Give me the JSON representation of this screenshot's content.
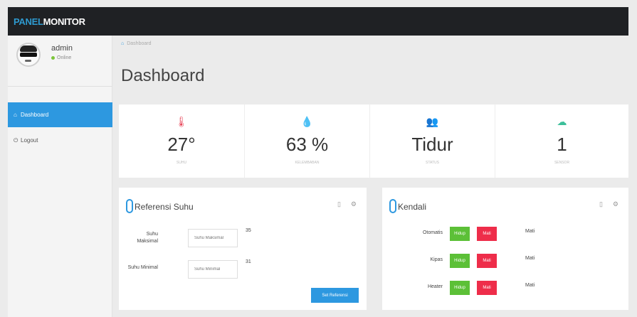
{
  "brand": {
    "part1": "PANEL",
    "part2": "MONITOR"
  },
  "user": {
    "name": "admin",
    "status": "Online"
  },
  "nav": [
    {
      "icon": "home-icon",
      "label": "Dashboard"
    },
    {
      "icon": "power-icon",
      "label": "Logout"
    }
  ],
  "breadcrumb": "Dashboard",
  "page_title": "Dashboard",
  "stats": [
    {
      "icon": "thermometer-icon",
      "value": "27°",
      "label": "SUHU"
    },
    {
      "icon": "water-drop-icon",
      "value": "63 %",
      "label": "KELEMBABAN"
    },
    {
      "icon": "users-icon",
      "value": "Tidur",
      "label": "STATUS"
    },
    {
      "icon": "cloud-icon",
      "value": "1",
      "label": "SENSOR"
    }
  ],
  "referensi": {
    "title": "Referensi Suhu",
    "max_label": "Suhu Maksimal",
    "max_placeholder": "Suhu Maksimal",
    "max_value": "35",
    "min_label": "Suhu Minimal",
    "min_placeholder": "Suhu Minimal",
    "min_value": "31",
    "button": "Set Referensi"
  },
  "kendali": {
    "title": "Kendali",
    "rows": [
      {
        "name": "Otomatis",
        "on": "Hidup",
        "off": "Mati",
        "status": "Mati"
      },
      {
        "name": "Kipas",
        "on": "Hidup",
        "off": "Mati",
        "status": "Mati"
      },
      {
        "name": "Heater",
        "on": "Hidup",
        "off": "Mati",
        "status": "Mati"
      }
    ]
  },
  "colors": {
    "topbar": "#1f2124",
    "accent": "#2d98e0",
    "on": "#5cc037",
    "off": "#ee2d4a"
  }
}
